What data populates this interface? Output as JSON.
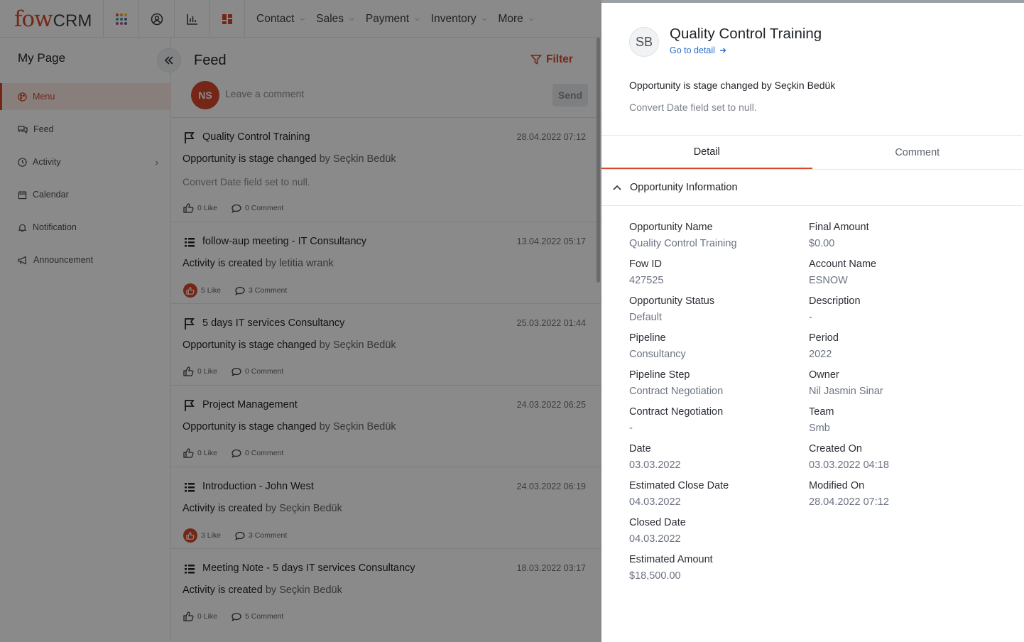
{
  "app": {
    "logo_main": "fow",
    "logo_suffix": "CRM"
  },
  "topnav": {
    "menus": [
      {
        "label": "Contact"
      },
      {
        "label": "Sales"
      },
      {
        "label": "Payment"
      },
      {
        "label": "Inventory"
      },
      {
        "label": "More"
      }
    ]
  },
  "sidebar": {
    "title": "My Page",
    "items": [
      {
        "label": "Menu",
        "icon": "palette-icon",
        "active": true
      },
      {
        "label": "Feed",
        "icon": "chat-icon"
      },
      {
        "label": "Activity",
        "icon": "clock-icon"
      },
      {
        "label": "Calendar",
        "icon": "calendar-icon"
      },
      {
        "label": "Notification",
        "icon": "bell-icon"
      },
      {
        "label": "Announcement",
        "icon": "megaphone-icon"
      }
    ]
  },
  "feed": {
    "title": "Feed",
    "filter_label": "Filter",
    "comment_placeholder": "Leave a comment",
    "user_initials": "NS",
    "send_label": "Send",
    "items": [
      {
        "icon": "flag-icon",
        "title": "Quality Control Training",
        "date": "28.04.2022 07:12",
        "action": "Opportunity is stage changed",
        "by": " by Seçkin Bedük",
        "sub": "Convert Date field set to null.",
        "likes": "0 Like",
        "comments": "0 Comment",
        "liked": false
      },
      {
        "icon": "list-icon",
        "title": "follow-aup meeting - IT Consultancy",
        "date": "13.04.2022 05:17",
        "action": "Activity is created",
        "by": " by letitia wrank",
        "sub": "",
        "likes": "5 Like",
        "comments": "3 Comment",
        "liked": true
      },
      {
        "icon": "flag-icon",
        "title": "5 days IT services Consultancy",
        "date": "25.03.2022 01:44",
        "action": "Opportunity is stage changed",
        "by": " by Seçkin Bedük",
        "sub": "",
        "likes": "0 Like",
        "comments": "0 Comment",
        "liked": false
      },
      {
        "icon": "flag-icon",
        "title": "Project Management",
        "date": "24.03.2022 06:25",
        "action": "Opportunity is stage changed",
        "by": " by Seçkin Bedük",
        "sub": "",
        "likes": "0 Like",
        "comments": "0 Comment",
        "liked": false
      },
      {
        "icon": "list-icon",
        "title": "Introduction - John West",
        "date": "24.03.2022 06:19",
        "action": "Activity is created",
        "by": " by Seçkin Bedük",
        "sub": "",
        "likes": "3 Like",
        "comments": "3 Comment",
        "liked": true
      },
      {
        "icon": "list-icon",
        "title": "Meeting Note - 5 days IT services Consultancy",
        "date": "18.03.2022 03:17",
        "action": "Activity is created",
        "by": " by Seçkin Bedük",
        "sub": "",
        "likes": "0 Like",
        "comments": "5 Comment",
        "liked": false
      }
    ]
  },
  "panel": {
    "avatar_initials": "SB",
    "title": "Quality Control Training",
    "goto_label": "Go to detail",
    "message": "Opportunity is stage changed by Seçkin Bedük",
    "sub": "Convert Date field set to null.",
    "tabs": [
      {
        "label": "Detail",
        "active": true
      },
      {
        "label": "Comment",
        "active": false
      }
    ],
    "section_title": "Opportunity Information",
    "fields_left": [
      {
        "label": "Opportunity Name",
        "value": "Quality Control Training"
      },
      {
        "label": "Fow ID",
        "value": "427525"
      },
      {
        "label": "Opportunity Status",
        "value": "Default"
      },
      {
        "label": "Pipeline",
        "value": "Consultancy"
      },
      {
        "label": "Pipeline Step",
        "value": "Contract Negotiation"
      },
      {
        "label": "Contract Negotiation",
        "value": "-"
      },
      {
        "label": "Date",
        "value": "03.03.2022"
      },
      {
        "label": "Estimated Close Date",
        "value": "04.03.2022"
      },
      {
        "label": "Closed Date",
        "value": "04.03.2022"
      },
      {
        "label": "Estimated Amount",
        "value": "$18,500.00"
      }
    ],
    "fields_right": [
      {
        "label": "Final Amount",
        "value": "$0.00"
      },
      {
        "label": "Account Name",
        "value": "ESNOW"
      },
      {
        "label": "Description",
        "value": "-"
      },
      {
        "label": "Period",
        "value": "2022"
      },
      {
        "label": "Owner",
        "value": "Nil Jasmin Sinar"
      },
      {
        "label": "Team",
        "value": "Smb"
      },
      {
        "label": "Created On",
        "value": "03.03.2022 04:18"
      },
      {
        "label": "Modified On",
        "value": "28.04.2022 07:12"
      }
    ]
  },
  "colors": {
    "accent": "#d9472b",
    "link": "#2a6fc9"
  }
}
